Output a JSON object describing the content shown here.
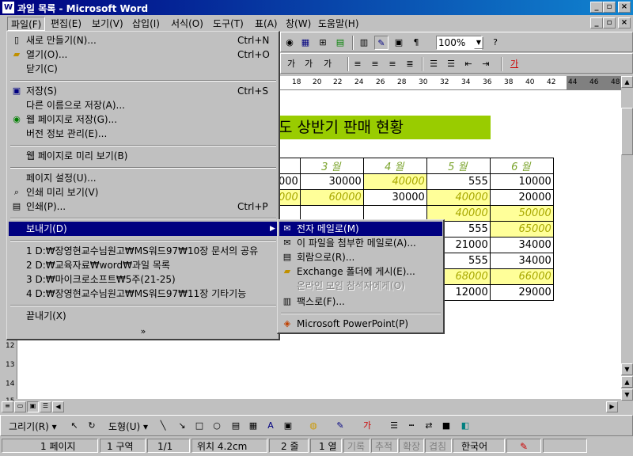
{
  "window": {
    "title": "과일 목록 - Microsoft Word",
    "icon": "W"
  },
  "menubar": [
    "파일(F)",
    "편집(E)",
    "보기(V)",
    "삽입(I)",
    "서식(O)",
    "도구(T)",
    "표(A)",
    "창(W)",
    "도움말(H)"
  ],
  "toolbar": {
    "zoom": "100%"
  },
  "ruler": [
    "18",
    "20",
    "22",
    "24",
    "26",
    "28",
    "30",
    "32",
    "34",
    "36",
    "38",
    "40",
    "42",
    "44",
    "46",
    "48"
  ],
  "vruler": [
    "12",
    "13",
    "14",
    "15"
  ],
  "file_menu": {
    "new": {
      "label": "새로 만들기(N)...",
      "shortcut": "Ctrl+N"
    },
    "open": {
      "label": "열기(O)...",
      "shortcut": "Ctrl+O"
    },
    "close": {
      "label": "닫기(C)"
    },
    "save": {
      "label": "저장(S)",
      "shortcut": "Ctrl+S"
    },
    "save_as": {
      "label": "다른 이름으로 저장(A)..."
    },
    "save_web": {
      "label": "웹 페이지로 저장(G)..."
    },
    "versions": {
      "label": "버전 정보 관리(E)..."
    },
    "web_preview": {
      "label": "웹 페이지로 미리 보기(B)"
    },
    "page_setup": {
      "label": "페이지 설정(U)..."
    },
    "print_preview": {
      "label": "인쇄 미리 보기(V)"
    },
    "print": {
      "label": "인쇄(P)...",
      "shortcut": "Ctrl+P"
    },
    "send_to": {
      "label": "보내기(D)"
    },
    "recent": [
      "1 D:₩장영현교수님원고₩MS워드97₩10장 문서의 공유",
      "2 D:₩교육자료₩word₩과일 목록",
      "3 D:₩마이크로소프트₩5주(21-25)",
      "4 D:₩장영현교수님원고₩MS워드97₩11장 기타기능"
    ],
    "exit": {
      "label": "끝내기(X)"
    },
    "expand": "»"
  },
  "send_menu": {
    "mail": "전자 메일로(M)",
    "attach_mail": "이 파일을 첨부한 메일로(A)...",
    "routing": "회람으로(R)...",
    "exchange": "Exchange 폴더에 게시(E)...",
    "online_meeting": "온라인 모임 참석자에게(O)",
    "fax": "팩스로(F)...",
    "powerpoint": "Microsoft PowerPoint(P)"
  },
  "document": {
    "title": "도 상반기 판매 현황",
    "months": [
      "3 월",
      "4 월",
      "5 월",
      "6 월"
    ],
    "rows": [
      [
        "000",
        "30000",
        "40000",
        "555",
        "10000"
      ],
      [
        "000",
        "60000",
        "30000",
        "40000",
        "20000"
      ],
      [
        "",
        "",
        "",
        "40000",
        "50000"
      ],
      [
        "",
        "",
        "",
        "555",
        "65000"
      ],
      [
        "",
        "",
        "",
        "21000",
        "34000"
      ],
      [
        "",
        "",
        "",
        "555",
        "34000"
      ],
      [
        "",
        "",
        "",
        "68000",
        "66000"
      ],
      [
        "",
        "",
        "",
        "12000",
        "29000"
      ]
    ]
  },
  "drawing_toolbar": {
    "draw": "그리기(R)",
    "autoshape": "도형(U)"
  },
  "status": {
    "page": "1 페이지",
    "section": "1 구역",
    "pages": "1/1",
    "position": "위치 4.2cm",
    "line": "2 줄",
    "col": "1 열",
    "rec": "기록",
    "trk": "추적",
    "ext": "확장",
    "ovr": "겹침",
    "lang": "한국어"
  },
  "colors": {
    "title_bar": "#000080",
    "highlight": "#000080",
    "doc_title_bg": "#99cc00",
    "cell_yellow": "#ffff99"
  }
}
